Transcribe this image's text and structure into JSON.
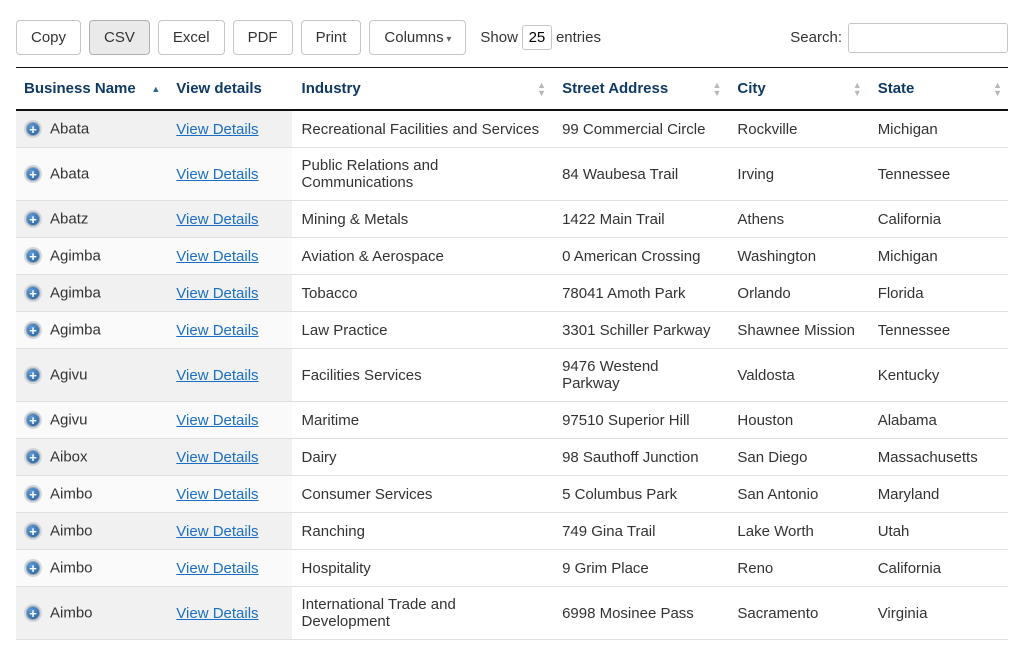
{
  "toolbar": {
    "copy": "Copy",
    "csv": "CSV",
    "excel": "Excel",
    "pdf": "PDF",
    "print": "Print",
    "columns": "Columns",
    "show_prefix": "Show",
    "entries_suffix": "entries",
    "length_value": "25",
    "search_label": "Search:"
  },
  "columns": {
    "business_name": "Business Name",
    "view_details": "View details",
    "industry": "Industry",
    "street_address": "Street Address",
    "city": "City",
    "state": "State"
  },
  "view_details_link": "View Details",
  "rows": [
    {
      "name": "Abata",
      "industry": "Recreational Facilities and Services",
      "street": "99 Commercial Circle",
      "city": "Rockville",
      "state": "Michigan"
    },
    {
      "name": "Abata",
      "industry": "Public Relations and Communications",
      "street": "84 Waubesa Trail",
      "city": "Irving",
      "state": "Tennessee"
    },
    {
      "name": "Abatz",
      "industry": "Mining & Metals",
      "street": "1422 Main Trail",
      "city": "Athens",
      "state": "California"
    },
    {
      "name": "Agimba",
      "industry": "Aviation & Aerospace",
      "street": "0 American Crossing",
      "city": "Washington",
      "state": "Michigan"
    },
    {
      "name": "Agimba",
      "industry": "Tobacco",
      "street": "78041 Amoth Park",
      "city": "Orlando",
      "state": "Florida"
    },
    {
      "name": "Agimba",
      "industry": "Law Practice",
      "street": "3301 Schiller Parkway",
      "city": "Shawnee Mission",
      "state": "Tennessee"
    },
    {
      "name": "Agivu",
      "industry": "Facilities Services",
      "street": "9476 Westend Parkway",
      "city": "Valdosta",
      "state": "Kentucky"
    },
    {
      "name": "Agivu",
      "industry": "Maritime",
      "street": "97510 Superior Hill",
      "city": "Houston",
      "state": "Alabama"
    },
    {
      "name": "Aibox",
      "industry": "Dairy",
      "street": "98 Sauthoff Junction",
      "city": "San Diego",
      "state": "Massachusetts"
    },
    {
      "name": "Aimbo",
      "industry": "Consumer Services",
      "street": "5 Columbus Park",
      "city": "San Antonio",
      "state": "Maryland"
    },
    {
      "name": "Aimbo",
      "industry": "Ranching",
      "street": "749 Gina Trail",
      "city": "Lake Worth",
      "state": "Utah"
    },
    {
      "name": "Aimbo",
      "industry": "Hospitality",
      "street": "9 Grim Place",
      "city": "Reno",
      "state": "California"
    },
    {
      "name": "Aimbo",
      "industry": "International Trade and Development",
      "street": "6998 Mosinee Pass",
      "city": "Sacramento",
      "state": "Virginia"
    }
  ]
}
